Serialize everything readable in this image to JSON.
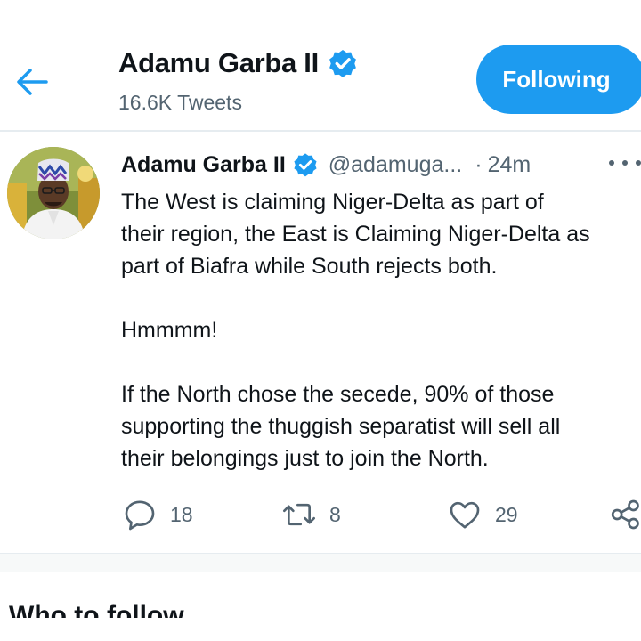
{
  "header": {
    "name": "Adamu Garba II",
    "tweet_count": "16.6K Tweets",
    "follow_label": "Following",
    "back_icon": "arrow-left-icon",
    "verified_icon": "verified-badge-icon"
  },
  "tweet": {
    "author_name": "Adamu Garba II",
    "handle": "@adamuga...",
    "separator": "·",
    "time": "24m",
    "lines": [
      "The West is claiming Niger-Delta as part of",
      "their region, the East is Claiming Niger-Delta as",
      "part of Biafra while South rejects both.",
      "",
      "Hmmmm!",
      "",
      "If the North chose the secede, 90% of those",
      "supporting the thuggish separatist will sell all",
      "their belongings just to join the North."
    ],
    "actions": {
      "reply_count": "18",
      "retweet_count": "8",
      "like_count": "29"
    }
  },
  "who_to_follow": {
    "title": "Who to follow"
  },
  "colors": {
    "accent": "#1d9bf0",
    "text_primary": "#0f1419",
    "text_secondary": "#536471",
    "divider": "#e6ecf0"
  }
}
